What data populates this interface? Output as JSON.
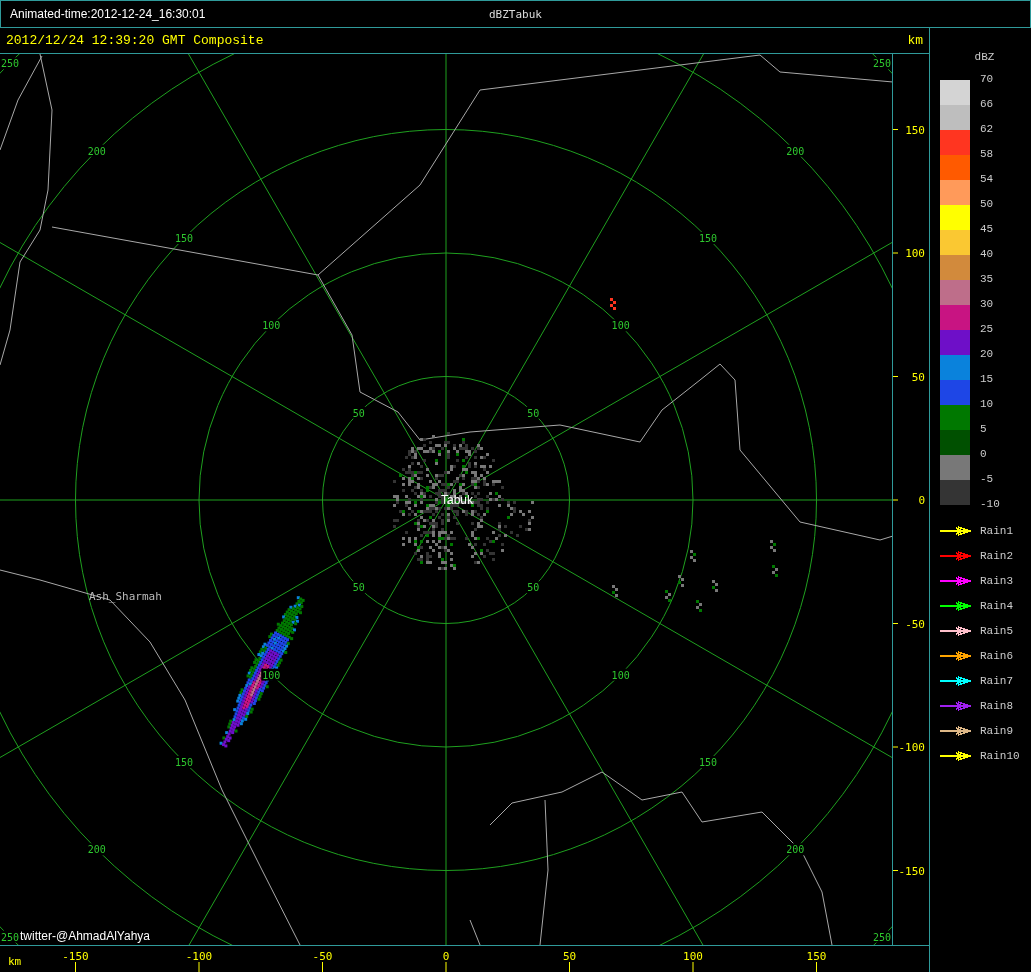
{
  "window": {
    "animated_time": "Animated-time:2012-12-24_16:30:01",
    "title": "dBZTabuk"
  },
  "map": {
    "header": "2012/12/24 12:39:20 GMT Composite",
    "unit": "km",
    "ring_labels": [
      {
        "labels": [
          "50",
          "50",
          "50",
          "50"
        ]
      },
      {
        "labels": [
          "100",
          "100",
          "100",
          "100"
        ]
      },
      {
        "labels": [
          "150",
          "150",
          "150",
          "150"
        ]
      },
      {
        "labels": [
          "200",
          "200",
          "200",
          "200"
        ]
      },
      {
        "labels": [
          "250",
          "250",
          "250",
          "250"
        ]
      }
    ],
    "places": [
      {
        "name": "Tabuk",
        "kind": "site"
      },
      {
        "name": "Ash_Sharmah",
        "kind": "town"
      }
    ],
    "credit": "twitter-@AhmadAlYahya"
  },
  "y_axis": {
    "ticks": [
      "150",
      "100",
      "50",
      "0",
      "-50",
      "-100",
      "-150"
    ]
  },
  "x_axis": {
    "unit": "km",
    "ticks": [
      "-150",
      "-100",
      "-50",
      "0",
      "50",
      "100",
      "150"
    ]
  },
  "legend": {
    "title": "dBZ",
    "scale": [
      {
        "label": "70",
        "color": "#d4d4d4"
      },
      {
        "label": "66",
        "color": "#bebebe"
      },
      {
        "label": "62",
        "color": "#ff3520"
      },
      {
        "label": "58",
        "color": "#ff5a00"
      },
      {
        "label": "54",
        "color": "#ff9a5a"
      },
      {
        "label": "50",
        "color": "#ffff00"
      },
      {
        "label": "45",
        "color": "#fac832"
      },
      {
        "label": "40",
        "color": "#d28a3c"
      },
      {
        "label": "35",
        "color": "#be6e8a"
      },
      {
        "label": "30",
        "color": "#c81482"
      },
      {
        "label": "25",
        "color": "#6e0fc8"
      },
      {
        "label": "20",
        "color": "#0a82dc"
      },
      {
        "label": "15",
        "color": "#1e46e6"
      },
      {
        "label": "10",
        "color": "#007800"
      },
      {
        "label": "5",
        "color": "#005000"
      },
      {
        "label": "0",
        "color": "#787878"
      },
      {
        "label": "-5",
        "color": "#343434"
      }
    ],
    "bottom_label": "-10",
    "tracks": [
      {
        "label": "Rain1",
        "color": "#ffff00"
      },
      {
        "label": "Rain2",
        "color": "#ff0000"
      },
      {
        "label": "Rain3",
        "color": "#ff00ff"
      },
      {
        "label": "Rain4",
        "color": "#00ff00"
      },
      {
        "label": "Rain5",
        "color": "#ffc0cb"
      },
      {
        "label": "Rain6",
        "color": "#ffa500"
      },
      {
        "label": "Rain7",
        "color": "#00ffff"
      },
      {
        "label": "Rain8",
        "color": "#a020f0"
      },
      {
        "label": "Rain9",
        "color": "#deb887"
      },
      {
        "label": "Rain10",
        "color": "#ffff00"
      }
    ]
  }
}
